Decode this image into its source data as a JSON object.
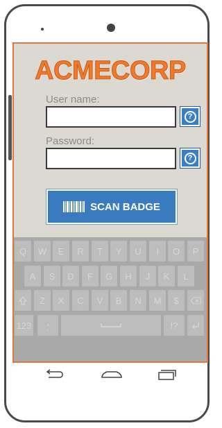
{
  "brand": {
    "name": "ACMECORP",
    "color": "#f07a2a"
  },
  "form": {
    "username_label": "User name:",
    "username_value": "",
    "password_label": "Password:",
    "password_value": "",
    "help_glyph": "?"
  },
  "scan_button": {
    "label": "SCAN BADGE",
    "icon": "barcode-icon"
  },
  "keyboard": {
    "row1": [
      "Q",
      "W",
      "E",
      "R",
      "T",
      "Y",
      "U",
      "I",
      "O",
      "P"
    ],
    "row2": [
      "A",
      "S",
      "D",
      "F",
      "G",
      "H",
      "J",
      "K",
      "L"
    ],
    "row3": [
      "Z",
      "X",
      "C",
      "V",
      "B",
      "N",
      "M",
      "$"
    ],
    "shift_icon": "shift-icon",
    "backspace_icon": "backspace-icon",
    "numbers_label": "123",
    "comma_label": ",",
    "period_label": ".",
    "space_icon": "space-icon",
    "punct_label": "!?",
    "enter_icon": "enter-icon"
  },
  "nav": {
    "back_icon": "back-icon",
    "home_icon": "home-icon",
    "recents_icon": "recents-icon"
  },
  "colors": {
    "accent": "#3a7bc0",
    "screen_border": "#e8753a",
    "keyboard_bg": "#a9a9a9"
  }
}
